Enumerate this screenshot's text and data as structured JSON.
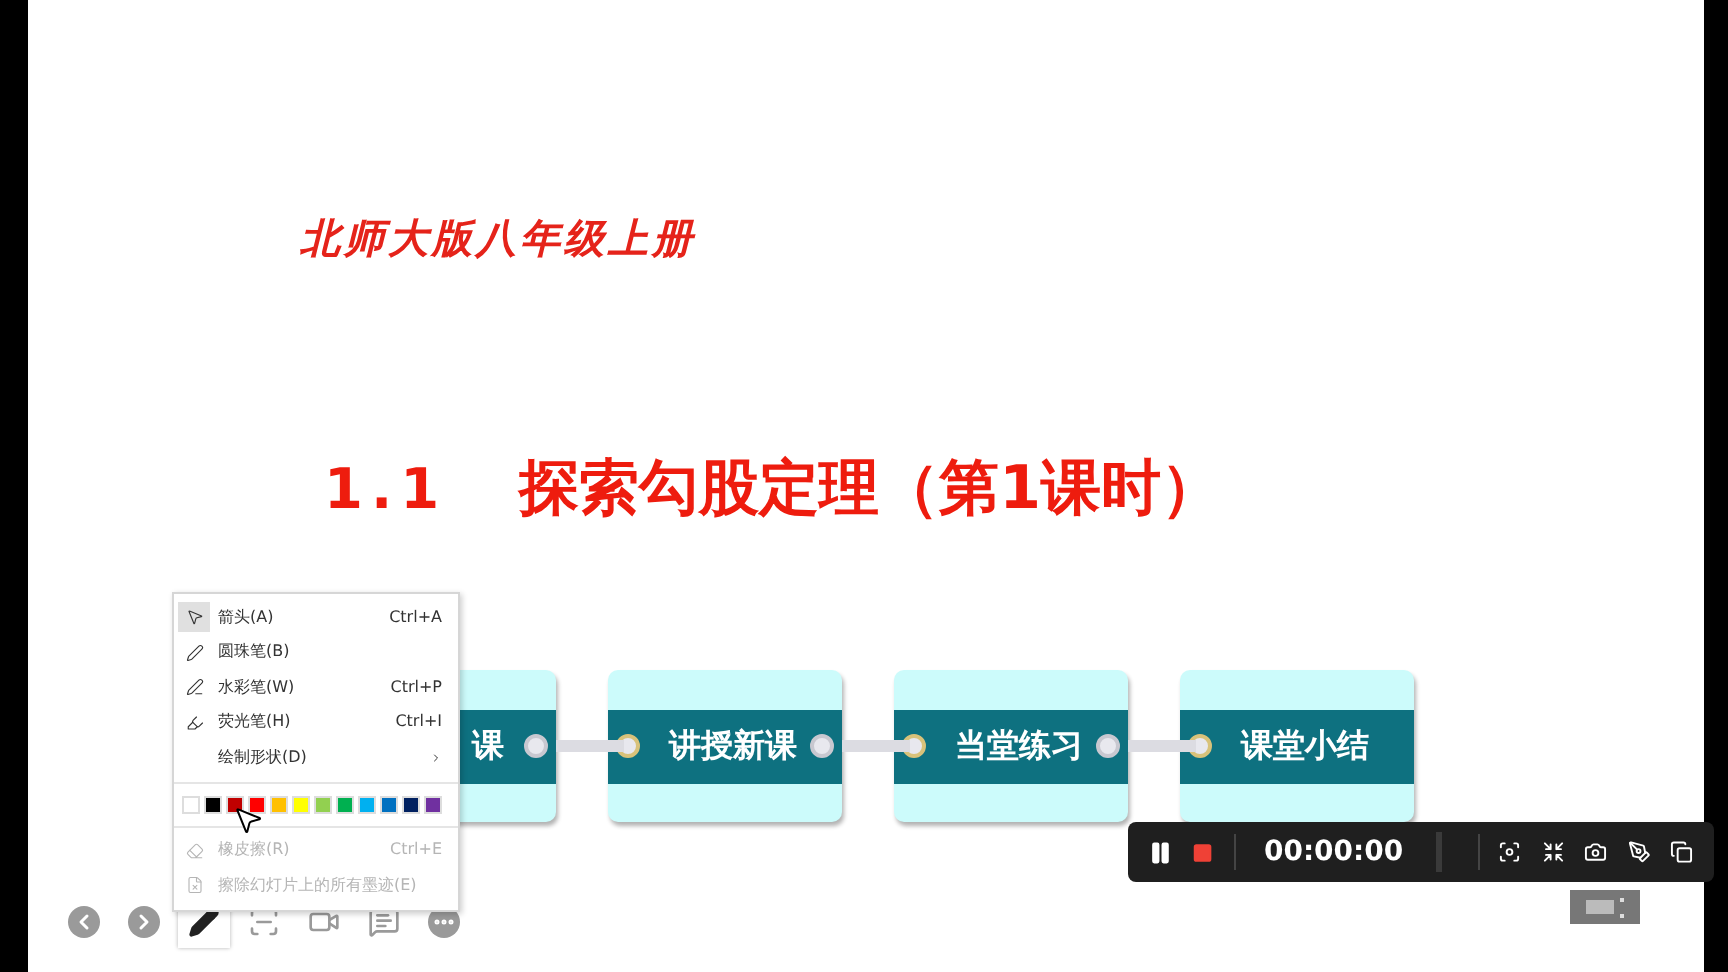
{
  "slide": {
    "subtitle": "北师大版八年级上册",
    "section_number": "1.1",
    "title": "探索勾股定理（第1课时）",
    "steps": [
      {
        "label": "课",
        "clipped": true
      },
      {
        "label": "讲授新课",
        "clipped": false
      },
      {
        "label": "当堂练习",
        "clipped": false
      },
      {
        "label": "课堂小结",
        "clipped": false
      }
    ]
  },
  "pen_menu": {
    "items": [
      {
        "kind": "tool",
        "label": "箭头(A)",
        "shortcut": "Ctrl+A",
        "selected": true,
        "disabled": false
      },
      {
        "kind": "tool",
        "label": "圆珠笔(B)",
        "selected": false,
        "disabled": false
      },
      {
        "kind": "tool",
        "label": "水彩笔(W)",
        "shortcut": "Ctrl+P",
        "selected": false,
        "disabled": false
      },
      {
        "kind": "tool",
        "label": "荧光笔(H)",
        "shortcut": "Ctrl+I",
        "selected": false,
        "disabled": false
      },
      {
        "kind": "submenu",
        "label": "绘制形状(D)",
        "selected": false,
        "disabled": false
      },
      {
        "kind": "colors",
        "colors": [
          {
            "color": "#ffffff"
          },
          {
            "color": "#000000"
          },
          {
            "color": "#c00000"
          },
          {
            "color": "#ff0000"
          },
          {
            "color": "#ffc000"
          },
          {
            "color": "#ffff00"
          },
          {
            "color": "#92d050"
          },
          {
            "color": "#00b050"
          },
          {
            "color": "#00b0f0"
          },
          {
            "color": "#0070c0"
          },
          {
            "color": "#002060"
          },
          {
            "color": "#7030a0"
          }
        ]
      },
      {
        "kind": "tool",
        "label": "橡皮擦(R)",
        "shortcut": "Ctrl+E",
        "selected": false,
        "disabled": true
      },
      {
        "kind": "tool",
        "label": "擦除幻灯片上的所有墨迹(E)",
        "selected": false,
        "disabled": true
      }
    ]
  },
  "slideshow_toolbar": [
    {
      "selected": false
    },
    {
      "selected": false
    },
    {
      "selected": true
    },
    {
      "selected": false
    },
    {
      "selected": false
    },
    {
      "selected": false
    },
    {
      "selected": false
    }
  ],
  "recorder": {
    "time": "00:00:00"
  }
}
